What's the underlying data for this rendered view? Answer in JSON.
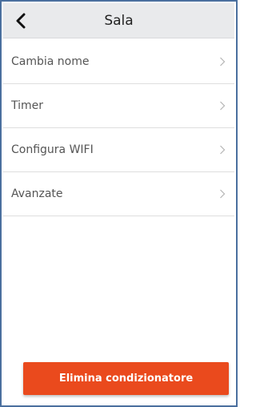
{
  "header": {
    "title": "Sala",
    "back_icon": "chevron-left-icon"
  },
  "menu": {
    "items": [
      {
        "label": "Cambia nome",
        "icon": "chevron-right-icon"
      },
      {
        "label": "Timer",
        "icon": "chevron-right-icon"
      },
      {
        "label": "Configura WIFI",
        "icon": "chevron-right-icon"
      },
      {
        "label": "Avanzate",
        "icon": "chevron-right-icon"
      }
    ]
  },
  "actions": {
    "delete_label": "Elimina condizionatore"
  },
  "colors": {
    "header_bg": "#e9eaec",
    "delete_button": "#ea4a1d",
    "frame_border": "#4a6f9e"
  }
}
